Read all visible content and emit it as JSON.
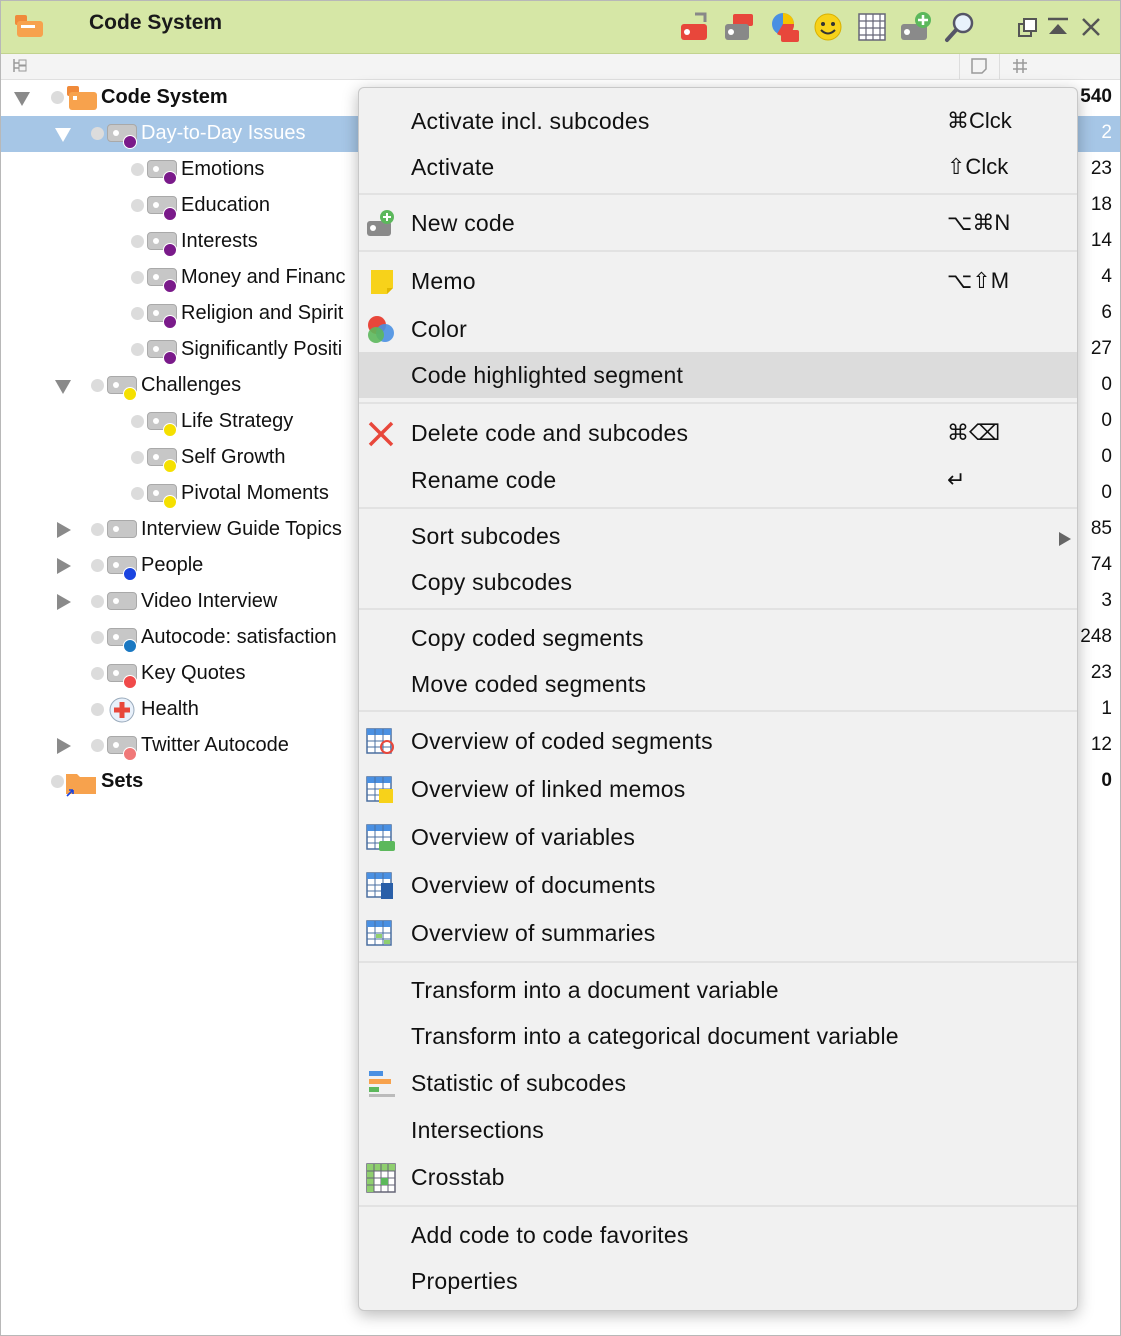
{
  "title": "Code System",
  "tree": [
    {
      "label": "Code System",
      "count": "540"
    },
    {
      "label": "Day-to-Day Issues",
      "count": "2"
    },
    {
      "label": "Emotions",
      "count": "23"
    },
    {
      "label": "Education",
      "count": "18"
    },
    {
      "label": "Interests",
      "count": "14"
    },
    {
      "label": "Money and Financ",
      "count": "4"
    },
    {
      "label": "Religion and Spirit",
      "count": "6"
    },
    {
      "label": "Significantly Positi",
      "count": "27"
    },
    {
      "label": "Challenges",
      "count": "0"
    },
    {
      "label": "Life Strategy",
      "count": "0"
    },
    {
      "label": "Self Growth",
      "count": "0"
    },
    {
      "label": "Pivotal Moments",
      "count": "0"
    },
    {
      "label": "Interview Guide Topics",
      "count": "85"
    },
    {
      "label": "People",
      "count": "74"
    },
    {
      "label": "Video Interview",
      "count": "3"
    },
    {
      "label": "Autocode: satisfaction",
      "count": "248"
    },
    {
      "label": "Key Quotes",
      "count": "23"
    },
    {
      "label": "Health",
      "count": "1"
    },
    {
      "label": "Twitter Autocode",
      "count": "12"
    },
    {
      "label": "Sets",
      "count": "0"
    }
  ],
  "menu": {
    "items": [
      {
        "label": "Activate incl. subcodes",
        "shortcut": "⌘Clck"
      },
      {
        "label": "Activate",
        "shortcut": "⇧Clck"
      },
      {
        "label": "New code",
        "shortcut": "⌥⌘N"
      },
      {
        "label": "Memo",
        "shortcut": "⌥⇧M"
      },
      {
        "label": "Color",
        "shortcut": ""
      },
      {
        "label": "Code highlighted segment",
        "shortcut": ""
      },
      {
        "label": "Delete code and subcodes",
        "shortcut": "⌘⌫"
      },
      {
        "label": "Rename code",
        "shortcut": "↵"
      },
      {
        "label": "Sort subcodes",
        "shortcut": ""
      },
      {
        "label": "Copy subcodes",
        "shortcut": ""
      },
      {
        "label": "Copy coded segments",
        "shortcut": ""
      },
      {
        "label": "Move coded segments",
        "shortcut": ""
      },
      {
        "label": "Overview of coded segments",
        "shortcut": ""
      },
      {
        "label": "Overview of linked memos",
        "shortcut": ""
      },
      {
        "label": "Overview of variables",
        "shortcut": ""
      },
      {
        "label": "Overview of documents",
        "shortcut": ""
      },
      {
        "label": "Overview of summaries",
        "shortcut": ""
      },
      {
        "label": "Transform into a document variable",
        "shortcut": ""
      },
      {
        "label": "Transform into a categorical document variable",
        "shortcut": ""
      },
      {
        "label": "Statistic of subcodes",
        "shortcut": ""
      },
      {
        "label": "Intersections",
        "shortcut": ""
      },
      {
        "label": "Crosstab",
        "shortcut": ""
      },
      {
        "label": "Add code to code favorites",
        "shortcut": ""
      },
      {
        "label": "Properties",
        "shortcut": ""
      }
    ]
  },
  "colors": {
    "titlebar": "#d6e7a6",
    "selection": "#a6c6e6",
    "purple": "#7a1a8a",
    "yellow": "#f5e000",
    "blue": "#1a44e0",
    "teal": "#1a78c2",
    "red": "#f04a4a",
    "pink": "#f07878"
  },
  "icons": [
    "code-system-icon",
    "activate-icon",
    "code-set-icon",
    "chart-icon",
    "smiley-icon",
    "table-icon",
    "new-code-icon",
    "search-icon",
    "undock-icon",
    "collapse-icon",
    "close-icon"
  ]
}
